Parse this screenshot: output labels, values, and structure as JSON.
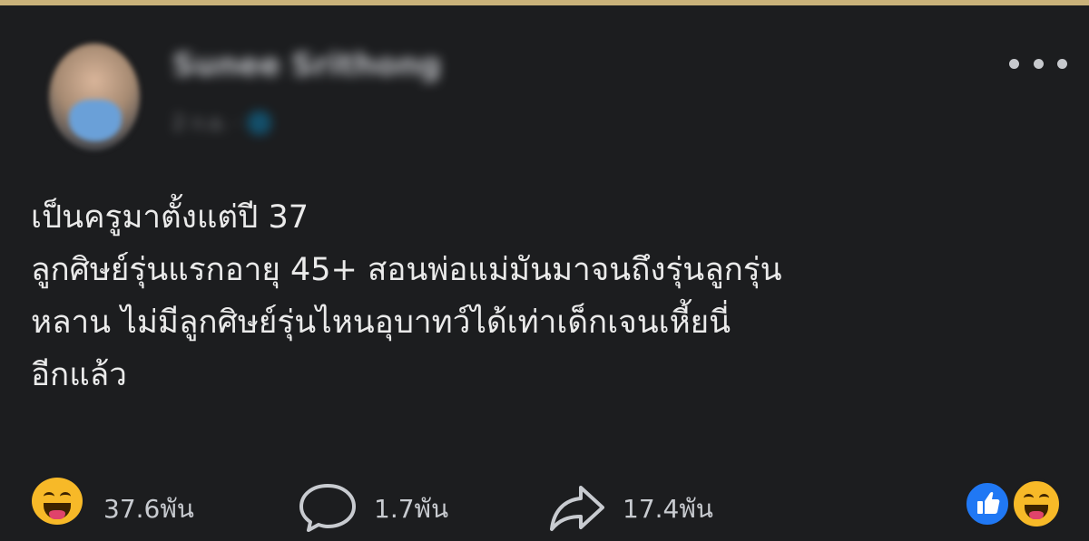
{
  "post": {
    "author_name": "Sunee Srithong",
    "meta": "2 ก.ย. · 🌐",
    "lines": [
      "เป็นครูมาตั้งแต่ปี 37",
      "ลูกศิษย์รุ่นแรกอายุ 45+ สอนพ่อแม่มันมาจนถึงรุ่นลูกรุ่น",
      "หลาน ไม่มีลูกศิษย์รุ่นไหนอุบาทว์ได้เท่าเด็กเจนเหี้ยนี่",
      "อีกแล้ว"
    ]
  },
  "stats": {
    "reactions": "37.6พัน",
    "comments": "1.7พัน",
    "shares": "17.4พัน"
  },
  "icons": {
    "more": "more-options-icon",
    "reaction": "haha-emoji-icon",
    "comment": "comment-icon",
    "share": "share-icon",
    "like": "like-icon"
  },
  "colors": {
    "background": "#1c1d1f",
    "text": "#eaeaea",
    "like_blue": "#2078f4",
    "haha_yellow": "#f7b928"
  }
}
